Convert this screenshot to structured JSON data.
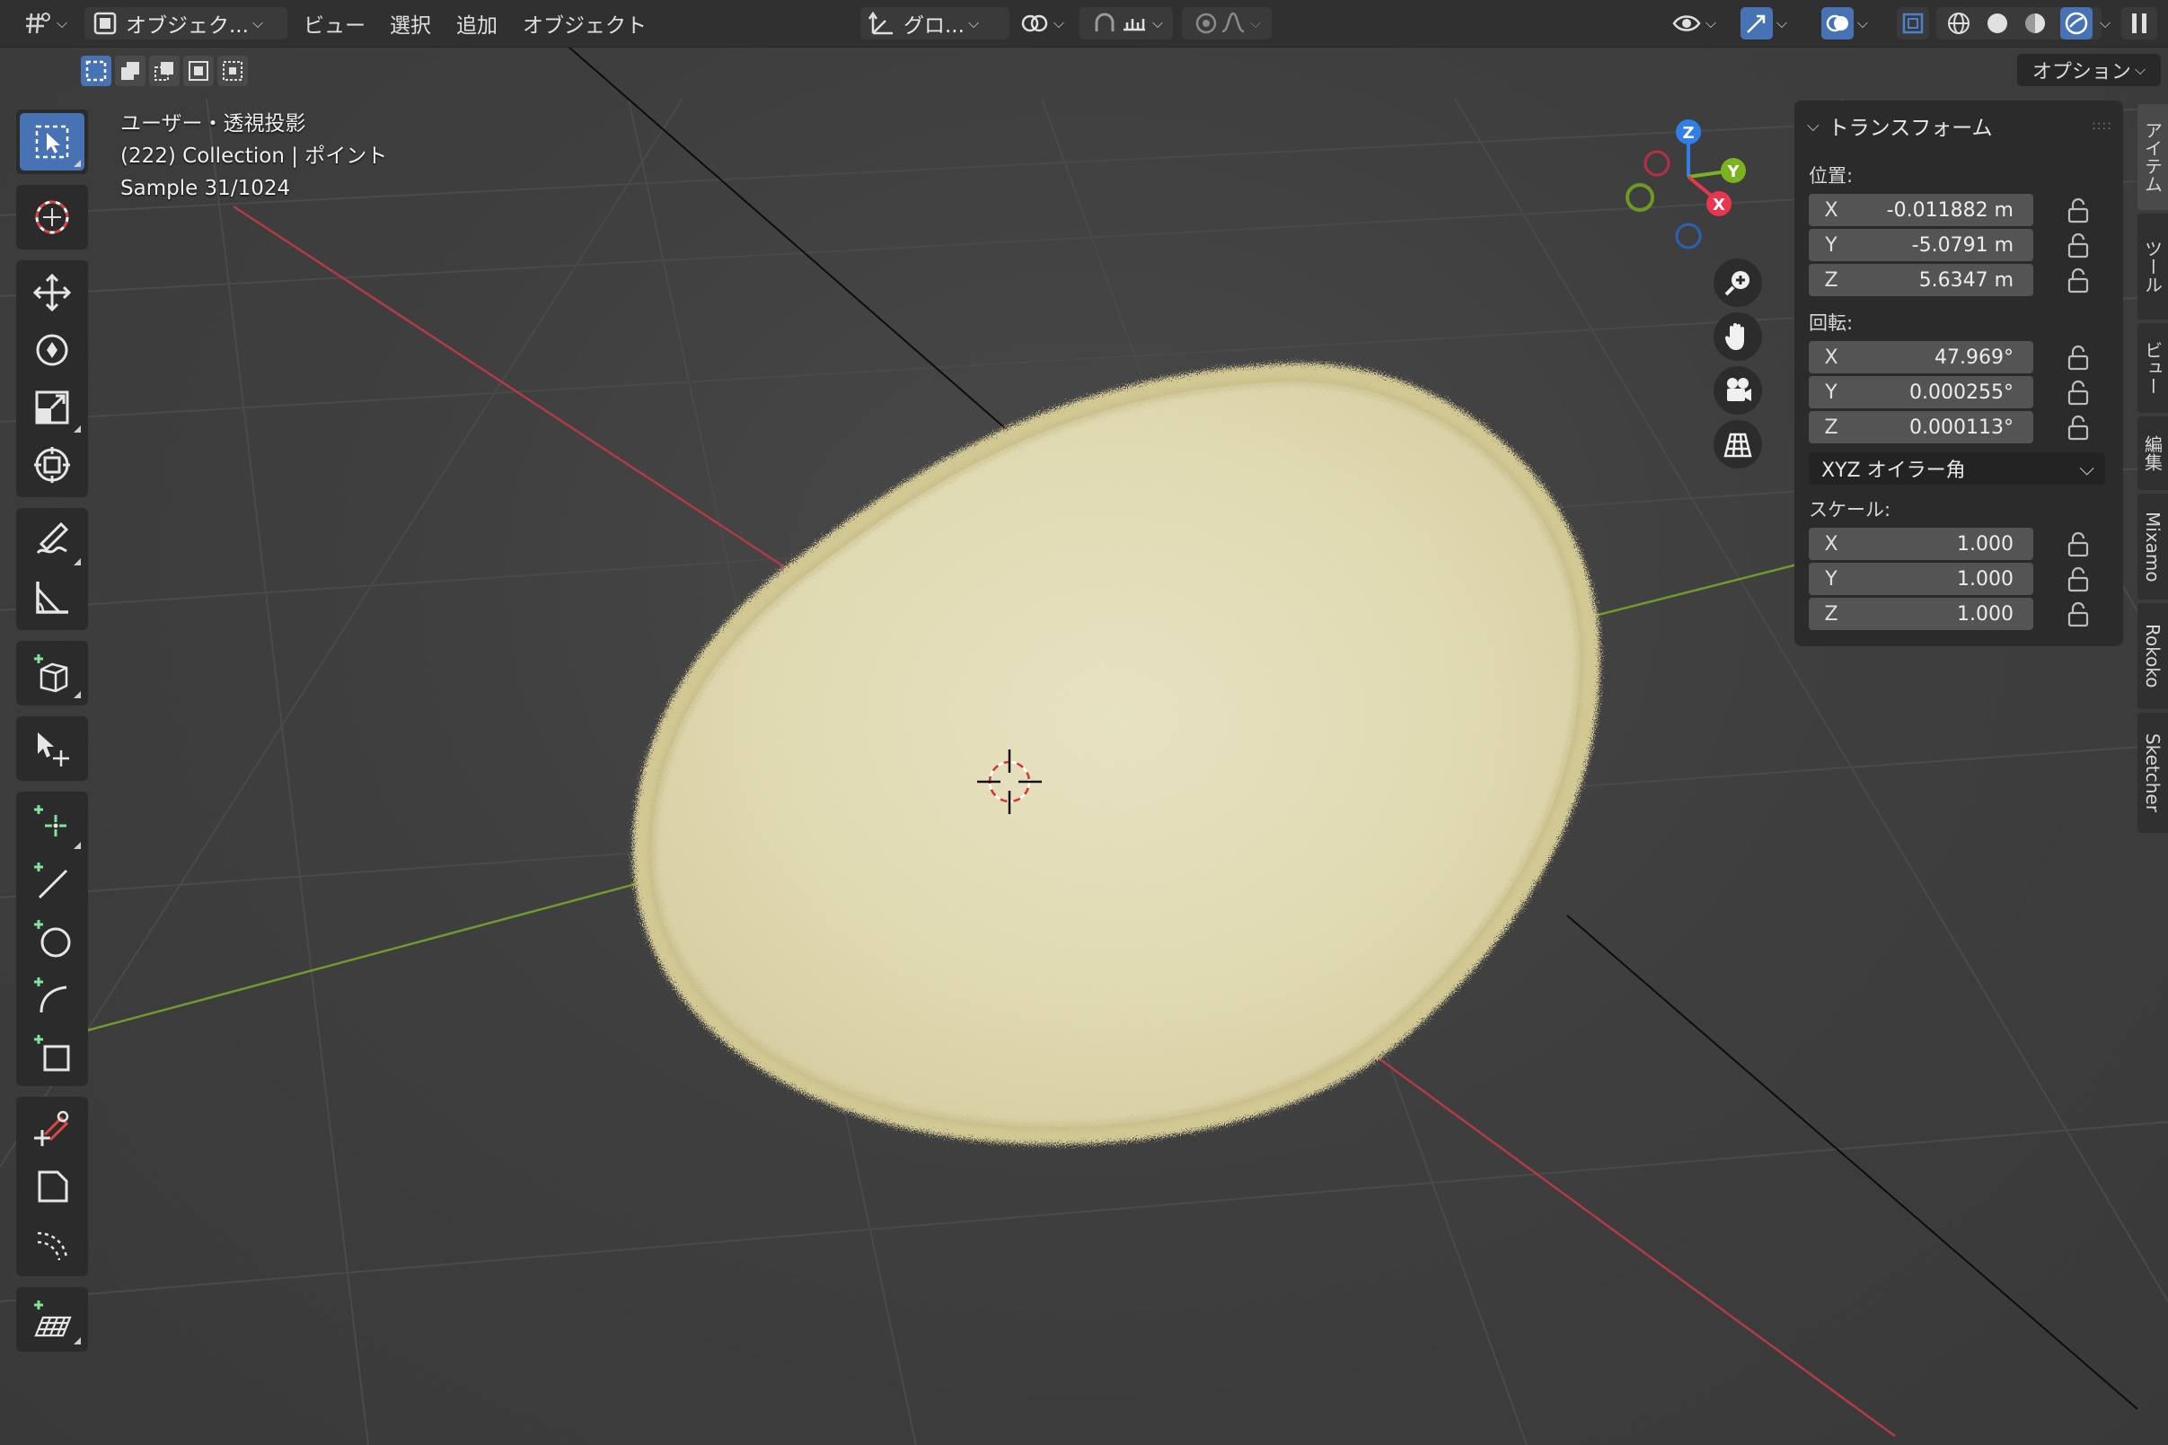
{
  "header": {
    "editor_type_icon": "grid-editor-icon",
    "mode_label": "オブジェク...",
    "menu": [
      "ビュー",
      "選択",
      "追加",
      "オブジェクト"
    ],
    "transform_orientation": "グロ...",
    "options_label": "オプション"
  },
  "viewport": {
    "view_name": "ユーザー・透視投影",
    "collection_info": "(222) Collection | ポイント",
    "sample_info": "Sample 31/1024"
  },
  "gizmo": {
    "x_label": "X",
    "y_label": "Y",
    "z_label": "Z"
  },
  "npanel": {
    "title": "トランスフォーム",
    "location_label": "位置:",
    "location": [
      {
        "axis": "X",
        "value": "-0.011882 m"
      },
      {
        "axis": "Y",
        "value": "-5.0791 m"
      },
      {
        "axis": "Z",
        "value": "5.6347 m"
      }
    ],
    "rotation_label": "回転:",
    "rotation": [
      {
        "axis": "X",
        "value": "47.969°"
      },
      {
        "axis": "Y",
        "value": "0.000255°"
      },
      {
        "axis": "Z",
        "value": "0.000113°"
      }
    ],
    "rotation_mode": "XYZ オイラー角",
    "scale_label": "スケール:",
    "scale": [
      {
        "axis": "X",
        "value": "1.000"
      },
      {
        "axis": "Y",
        "value": "1.000"
      },
      {
        "axis": "Z",
        "value": "1.000"
      }
    ]
  },
  "side_tabs": [
    "アイテム",
    "ツール",
    "ビュー",
    "編集",
    "Mixamo",
    "Rokoko",
    "Sketcher"
  ],
  "colors": {
    "accent": "#4772b3",
    "axis_x": "#ff3352",
    "axis_y": "#8bdc00",
    "axis_z": "#2890ff",
    "fur": "#e4ddb0"
  }
}
